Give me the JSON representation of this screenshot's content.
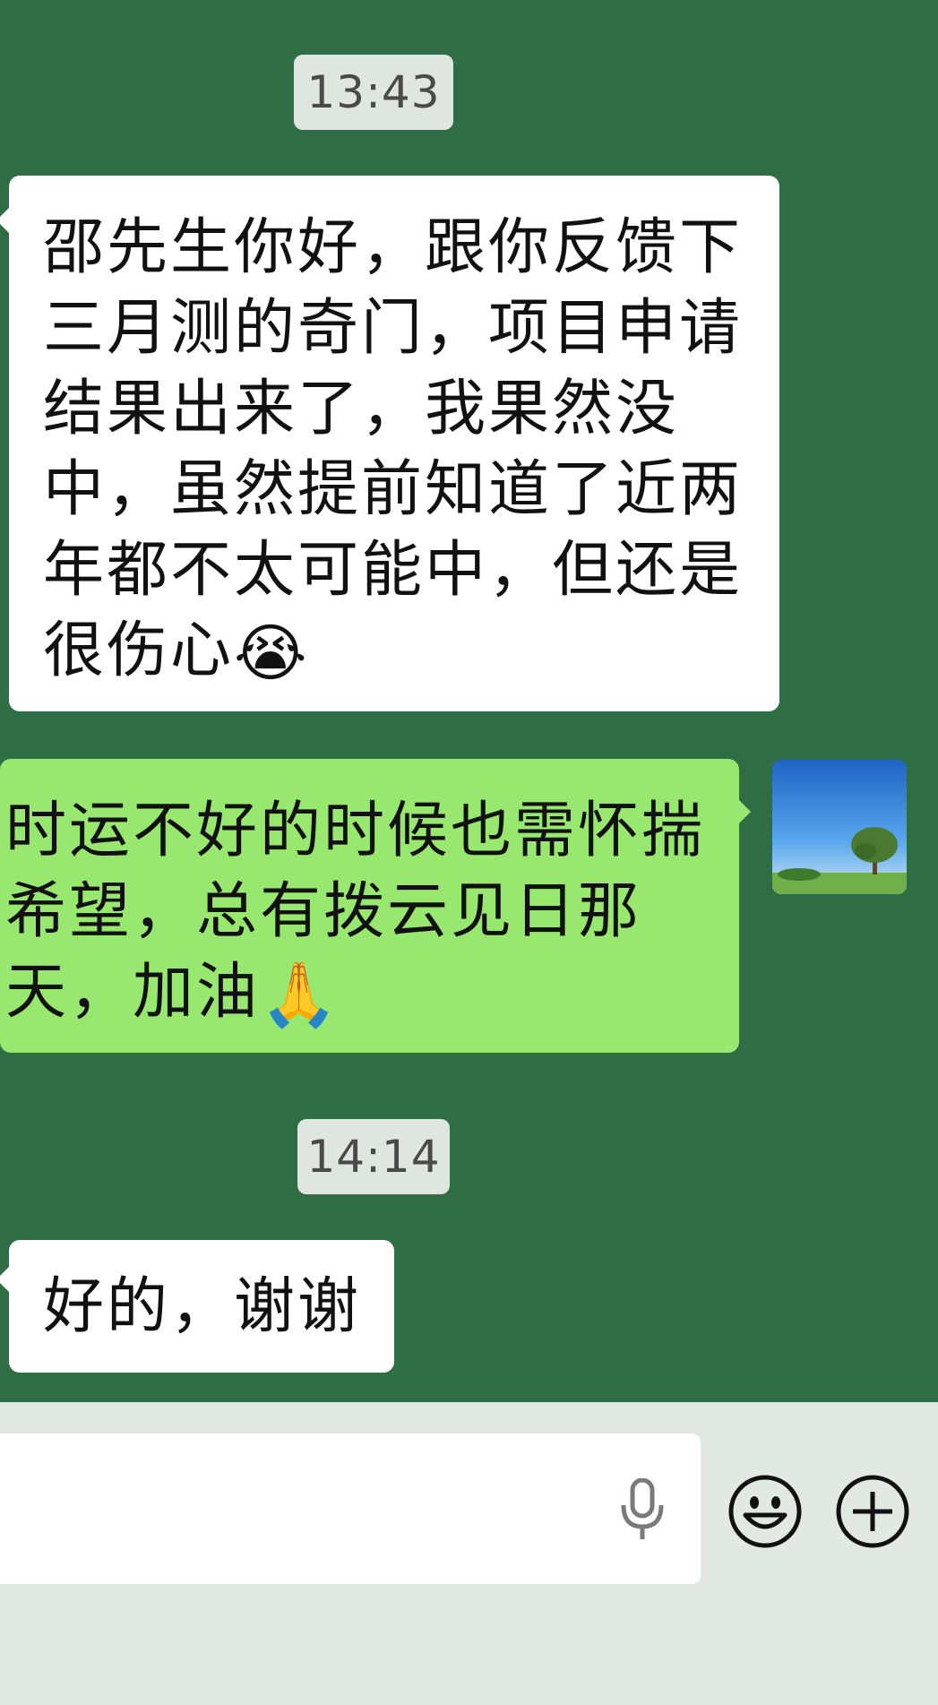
{
  "chat": {
    "time_1": "13:43",
    "message_1": "邵先生你好，跟你反馈下三月测的奇门，项目申请结果出来了，我果然没中，虽然提前知道了近两年都不太可能中，但还是很伤心",
    "message_1_emoji": "😭",
    "message_2": "时运不好的时候也需怀揣希望，总有拨云见日那天，加油",
    "message_2_emoji": "🙏",
    "time_2": "14:14",
    "message_3": "好的，谢谢"
  },
  "input_bar": {
    "icons": [
      "microphone-icon",
      "emoji-icon",
      "plus-icon"
    ]
  },
  "colors": {
    "chat_background": "#2f6e45",
    "incoming_bubble": "#ffffff",
    "outgoing_bubble": "#98e76f",
    "input_bar_background": "#e2e8e2",
    "time_badge": "#dfe5df"
  }
}
